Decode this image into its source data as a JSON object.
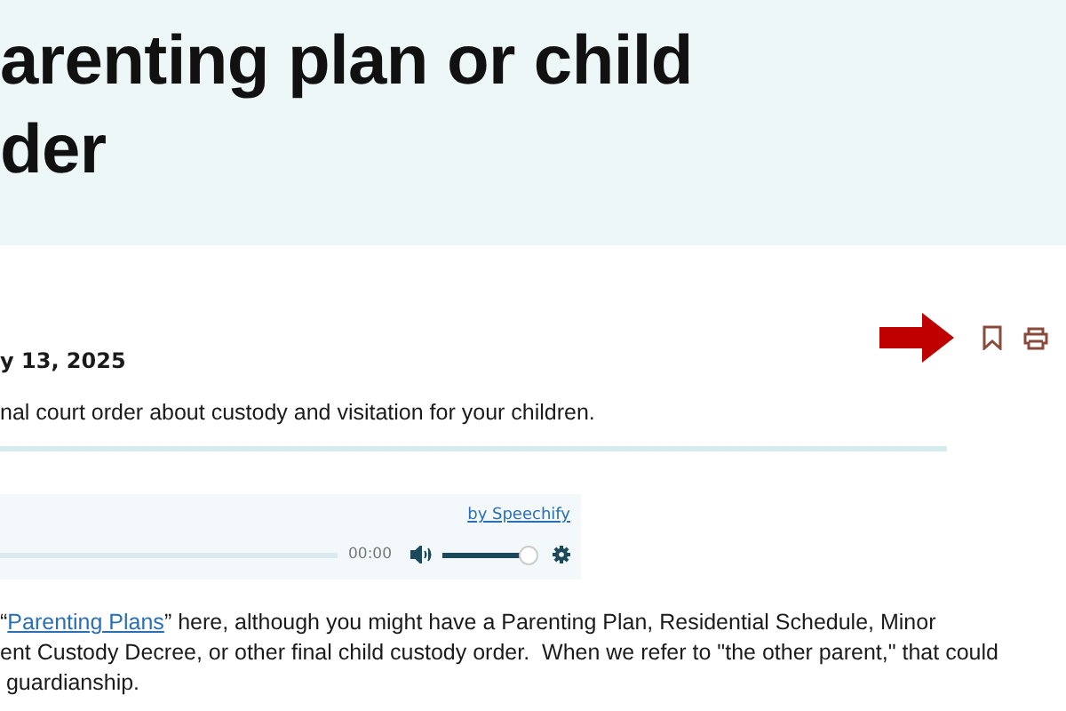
{
  "hero": {
    "title_lines": [
      "arenting plan or child",
      "der"
    ]
  },
  "date": "y 13, 2025",
  "summary": "nal court order about custody and visitation for your children.",
  "audio_player": {
    "credit": "by Speechify",
    "time": "00:00",
    "volume": {
      "level": 0.96
    }
  },
  "paragraph_lines": [
    {
      "before": "“",
      "link": "Parenting Plans",
      "after": "” here, although you might have a Parenting Plan, Residential Schedule, Minor"
    },
    {
      "before": "ent Custody Decree, or other final child custody order.  When we refer to \"the other parent,\" that could"
    },
    {
      "before": " guardianship."
    }
  ]
}
